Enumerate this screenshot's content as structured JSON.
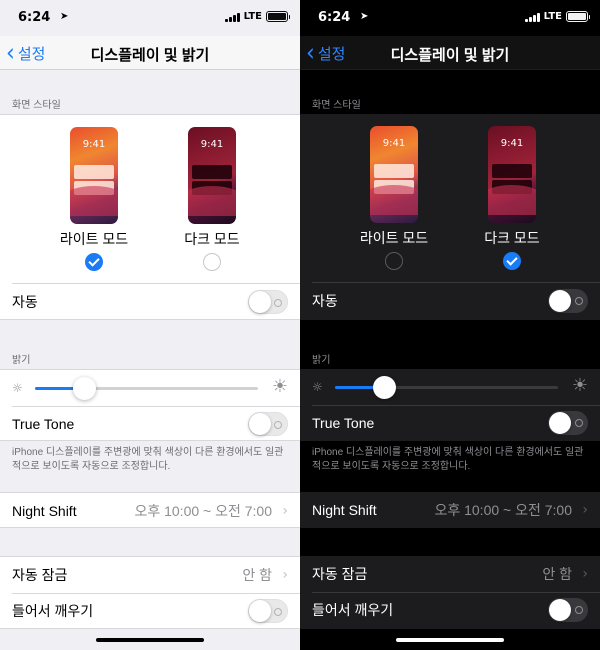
{
  "status": {
    "time": "6:24",
    "network": "LTE"
  },
  "nav": {
    "back_label": "설정",
    "title": "디스플레이 및 밝기"
  },
  "appearance": {
    "section_label": "화면 스타일",
    "preview_time": "9:41",
    "light_label": "라이트 모드",
    "dark_label": "다크 모드",
    "auto_label": "자동"
  },
  "brightness": {
    "section_label": "밝기",
    "level": 0.22,
    "true_tone_label": "True Tone",
    "footnote": "iPhone 디스플레이를 주변광에 맞춰 색상이 다른 환경에서도 일관적으로 보이도록 자동으로 조정합니다."
  },
  "night_shift": {
    "label": "Night Shift",
    "value": "오후 10:00 ~ 오전 7:00"
  },
  "auto_lock": {
    "label": "자동 잠금",
    "value": "안 함"
  },
  "raise_to_wake": {
    "label": "들어서 깨우기"
  },
  "screens": [
    {
      "mode": "light",
      "selected": "light"
    },
    {
      "mode": "dark",
      "selected": "dark"
    }
  ],
  "colors": {
    "accent": "#1a7cf5",
    "light_bg": "#efeff4",
    "dark_bg": "#000000",
    "dark_group": "#1c1c1e"
  }
}
